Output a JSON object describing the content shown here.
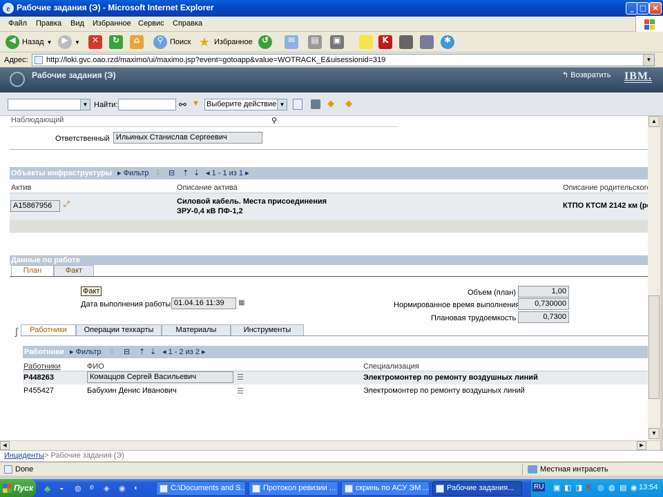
{
  "window": {
    "title": "Рабочие задания (Э) - Microsoft Internet Explorer"
  },
  "menu": [
    "Файл",
    "Правка",
    "Вид",
    "Избранное",
    "Сервис",
    "Справка"
  ],
  "toolbar": {
    "back": "Назад",
    "search": "Поиск",
    "favorites": "Избранное"
  },
  "address": {
    "label": "Адрес:",
    "url": "http://loki.gvc.oao.rzd/maximo/ui/maximo.jsp?event=gotoapp&value=WOTRACK_E&uisessionid=319"
  },
  "app": {
    "name": "Рабочие задания (Э)",
    "return": "Возвратить",
    "brand": "IBM."
  },
  "apptoolbar": {
    "find_label": "Найти:",
    "action_select": "Выберите действие"
  },
  "form": {
    "observer_label": "Наблюдающий",
    "responsible_label": "Ответственный",
    "responsible_value": "Ильиных Станислав Сергеевич"
  },
  "assets": {
    "title": "Объекты инфраструктуры",
    "filter": "Фильтр",
    "pager": "1 - 1 из 1",
    "columns": [
      "Актив",
      "Описание актива",
      "Описание родительского"
    ],
    "rows": [
      {
        "asset": "A15867956",
        "desc1": "Силовой кабель. Места присоединения",
        "desc2": "ЗРУ-0,4 кВ ПФ-1,2",
        "parent": "КТПО КТСМ 2142 км (ре"
      }
    ]
  },
  "work": {
    "title": "Данные по работе",
    "tabs": [
      "План",
      "Факт"
    ],
    "fact_label": "Факт",
    "date_label": "Дата выполнения работы",
    "date_value": "01.04.16 11:39",
    "volume_label": "Объем (план)",
    "volume_value": "1,00",
    "norm_label": "Нормированное время выполнения",
    "norm_value": "0,730000",
    "labor_label": "Плановая трудоемкость",
    "labor_value": "0,7300"
  },
  "subtabs": [
    "Работники",
    "Операции техкарты",
    "Материалы",
    "Инструменты"
  ],
  "workers": {
    "title": "Работники",
    "filter": "Фильтр",
    "pager": "1 - 2 из 2",
    "columns": [
      "Работники",
      "ФИО",
      "Специализация"
    ],
    "rows": [
      {
        "id": "P448263",
        "name": "Комаццов Сергей Васильевич",
        "spec": "Электромонтер по ремонту воздушных линий"
      },
      {
        "id": "P455427",
        "name": "Бабухин Денис Иванович",
        "spec": "Электромонтер по ремонту воздушных линий"
      }
    ]
  },
  "breadcrumb": {
    "link": "Инциденты",
    "current": "> Рабочие задания (Э)"
  },
  "status": {
    "left": "Done",
    "zone": "Местная интрасеть"
  },
  "taskbar": {
    "start": "Пуск",
    "tasks": [
      "C:\\Documents and S...",
      "Протокол ревизии ...",
      "скринь по АСУ ЭМ ...",
      "Рабочие задания..."
    ],
    "lang": "RU",
    "clock": "13:54"
  },
  "colors": {
    "section": "#b9c7d8",
    "header": "#2f445e",
    "taskbar": "#245edb"
  }
}
